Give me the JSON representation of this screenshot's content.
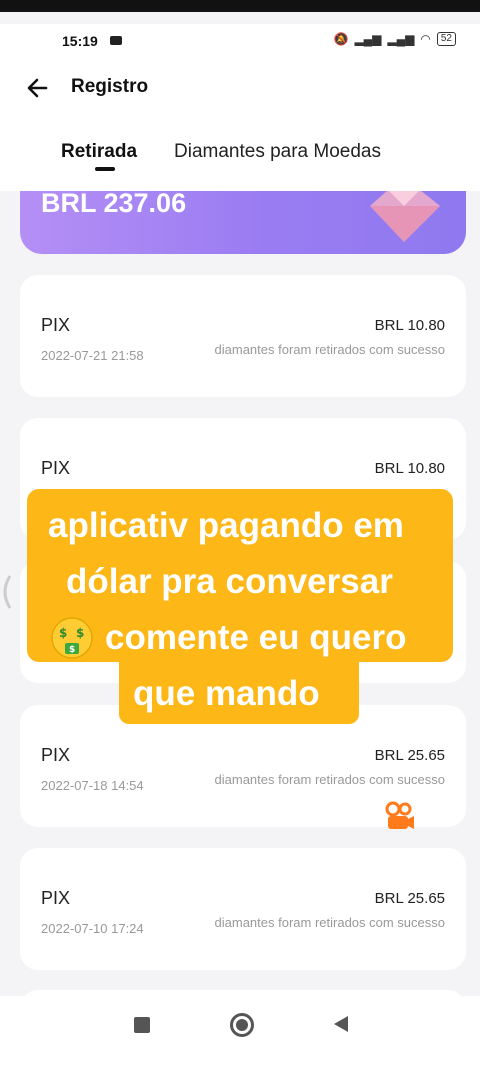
{
  "status": {
    "time": "15:19",
    "battery": "52"
  },
  "header": {
    "title": "Registro",
    "back_icon": "arrow-left-icon"
  },
  "tabs": [
    {
      "label": "Retirada",
      "active": true
    },
    {
      "label": "Diamantes para Moedas",
      "active": false
    }
  ],
  "balance": {
    "amount": "BRL 237.06",
    "icon": "diamond-icon"
  },
  "records": [
    {
      "method": "PIX",
      "amount": "BRL 10.80",
      "date": "2022-07-21 21:58",
      "description": "diamantes foram retirados com sucesso"
    },
    {
      "method": "PIX",
      "amount": "BRL 10.80",
      "date": "",
      "description": ""
    },
    {
      "method": "",
      "amount": "",
      "date": "",
      "description": ""
    },
    {
      "method": "PIX",
      "amount": "BRL 25.65",
      "date": "2022-07-18 14:54",
      "description": "diamantes foram retirados com sucesso"
    },
    {
      "method": "PIX",
      "amount": "BRL 25.65",
      "date": "2022-07-10 17:24",
      "description": "diamantes foram retirados com sucesso"
    }
  ],
  "overlay": {
    "lines": [
      "aplicativ pagando em",
      "dólar pra conversar",
      "comente eu quero",
      "que mando"
    ],
    "emoji_icon": "money-mouth-face-icon",
    "background_color": "#fdb717"
  },
  "watermark": {
    "icon": "kwai-logo-icon"
  },
  "colors": {
    "card_gradient_start": "#b48ff5",
    "card_gradient_end": "#8f79f0"
  }
}
